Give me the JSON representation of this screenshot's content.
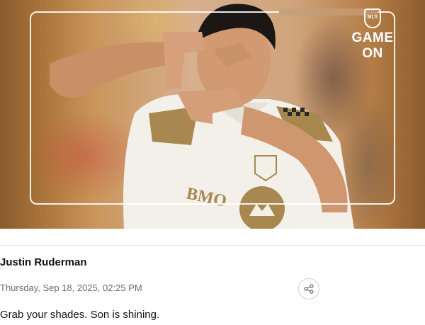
{
  "hero": {
    "brand": {
      "league_badge": "MLS",
      "line1": "GAME",
      "line2": "ON"
    },
    "jersey_sponsor": "BMO"
  },
  "post": {
    "author": "Justin Ruderman",
    "timestamp": "Thursday, Sep 18, 2025, 02:25 PM",
    "caption": "Grab your shades. Son is shining."
  },
  "icons": {
    "share": "share-icon"
  }
}
